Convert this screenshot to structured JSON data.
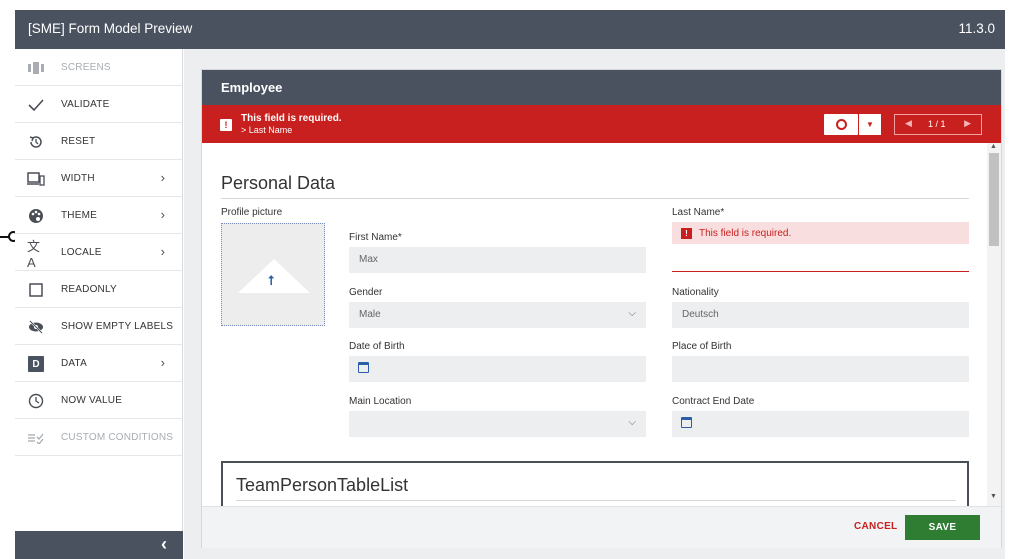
{
  "topbar": {
    "title": "[SME] Form Model Preview",
    "version": "11.3.0"
  },
  "sidebar": {
    "items": [
      {
        "label": "SCREENS",
        "icon": "screens-icon"
      },
      {
        "label": "VALIDATE",
        "icon": "check-icon"
      },
      {
        "label": "RESET",
        "icon": "reset-icon"
      },
      {
        "label": "WIDTH",
        "icon": "devices-icon"
      },
      {
        "label": "THEME",
        "icon": "palette-icon"
      },
      {
        "label": "LOCALE",
        "icon": "translate-icon"
      },
      {
        "label": "READONLY",
        "icon": "checkbox-icon"
      },
      {
        "label": "SHOW EMPTY LABELS",
        "icon": "eye-off-icon"
      },
      {
        "label": "DATA",
        "icon": "data-icon",
        "badge": "D"
      },
      {
        "label": "NOW VALUE",
        "icon": "clock-icon"
      },
      {
        "label": "CUSTOM CONDITIONS",
        "icon": "conditions-icon"
      }
    ]
  },
  "panel": {
    "title": "Employee",
    "error_bar": {
      "message": "This field is required.",
      "field": "> Last Name",
      "pager": "1 / 1"
    }
  },
  "form": {
    "section_title": "Personal Data",
    "profile_picture_label": "Profile picture",
    "first_name": {
      "label": "First Name*",
      "value": "Max"
    },
    "last_name": {
      "label": "Last Name*",
      "value": "",
      "error": "This field is required."
    },
    "gender": {
      "label": "Gender",
      "value": "Male"
    },
    "nationality": {
      "label": "Nationality",
      "value": "Deutsch"
    },
    "date_of_birth": {
      "label": "Date of Birth",
      "value": ""
    },
    "place_of_birth": {
      "label": "Place of Birth",
      "value": ""
    },
    "main_location": {
      "label": "Main Location",
      "value": ""
    },
    "contract_end_date": {
      "label": "Contract End Date",
      "value": ""
    },
    "table_title": "TeamPersonTableList"
  },
  "footer": {
    "cancel_label": "CANCEL",
    "save_label": "SAVE"
  },
  "colors": {
    "header": "#4a5260",
    "error": "#c8201f",
    "save": "#2e7d32"
  }
}
